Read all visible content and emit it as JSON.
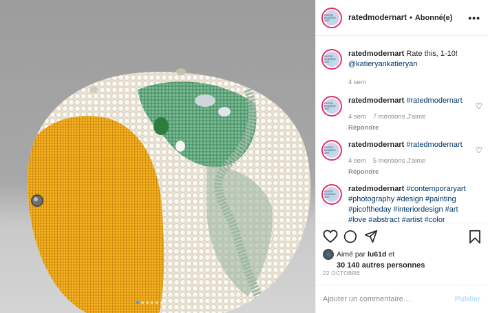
{
  "header": {
    "username": "ratedmodernart",
    "separator": "•",
    "follow_status": "Abonné(e)",
    "more": "•••",
    "avatar_text": "RATED MODERN ART"
  },
  "caption": {
    "username": "ratedmodernart",
    "text": "Rate this, 1-10!",
    "mention": "@katieryankatieryan",
    "time": "4 sem"
  },
  "comments": [
    {
      "username": "ratedmodernart",
      "text": "#ratedmodernart",
      "time": "4 sem",
      "likes": "7 mentions J’aime",
      "reply": "Répondre"
    },
    {
      "username": "ratedmodernart",
      "text": "#ratedmodernart",
      "time": "4 sem",
      "likes": "5 mentions J’aime",
      "reply": "Répondre"
    },
    {
      "username": "ratedmodernart",
      "text": "#contemporaryart #photography #design #painting #picoftheday #interiordesign #art #love #abstract #artist #color"
    }
  ],
  "likes": {
    "liked_by_prefix": "Aimé par",
    "liked_by_user": "lu61d",
    "liked_by_suffix": "et",
    "others": "30 140 autres personnes"
  },
  "post_date": "22 OCTOBRE",
  "add_comment": {
    "placeholder": "Ajouter un commentaire…",
    "publish": "Publier"
  },
  "carousel": {
    "current": 1,
    "total": 6
  },
  "colors": {
    "link": "#00376b",
    "muted": "#8e8e8e",
    "publish_disabled": "#b2dffc",
    "ring": "#e1306c",
    "lemon": "#f0a81a",
    "mold_green": "#5c9c72"
  }
}
